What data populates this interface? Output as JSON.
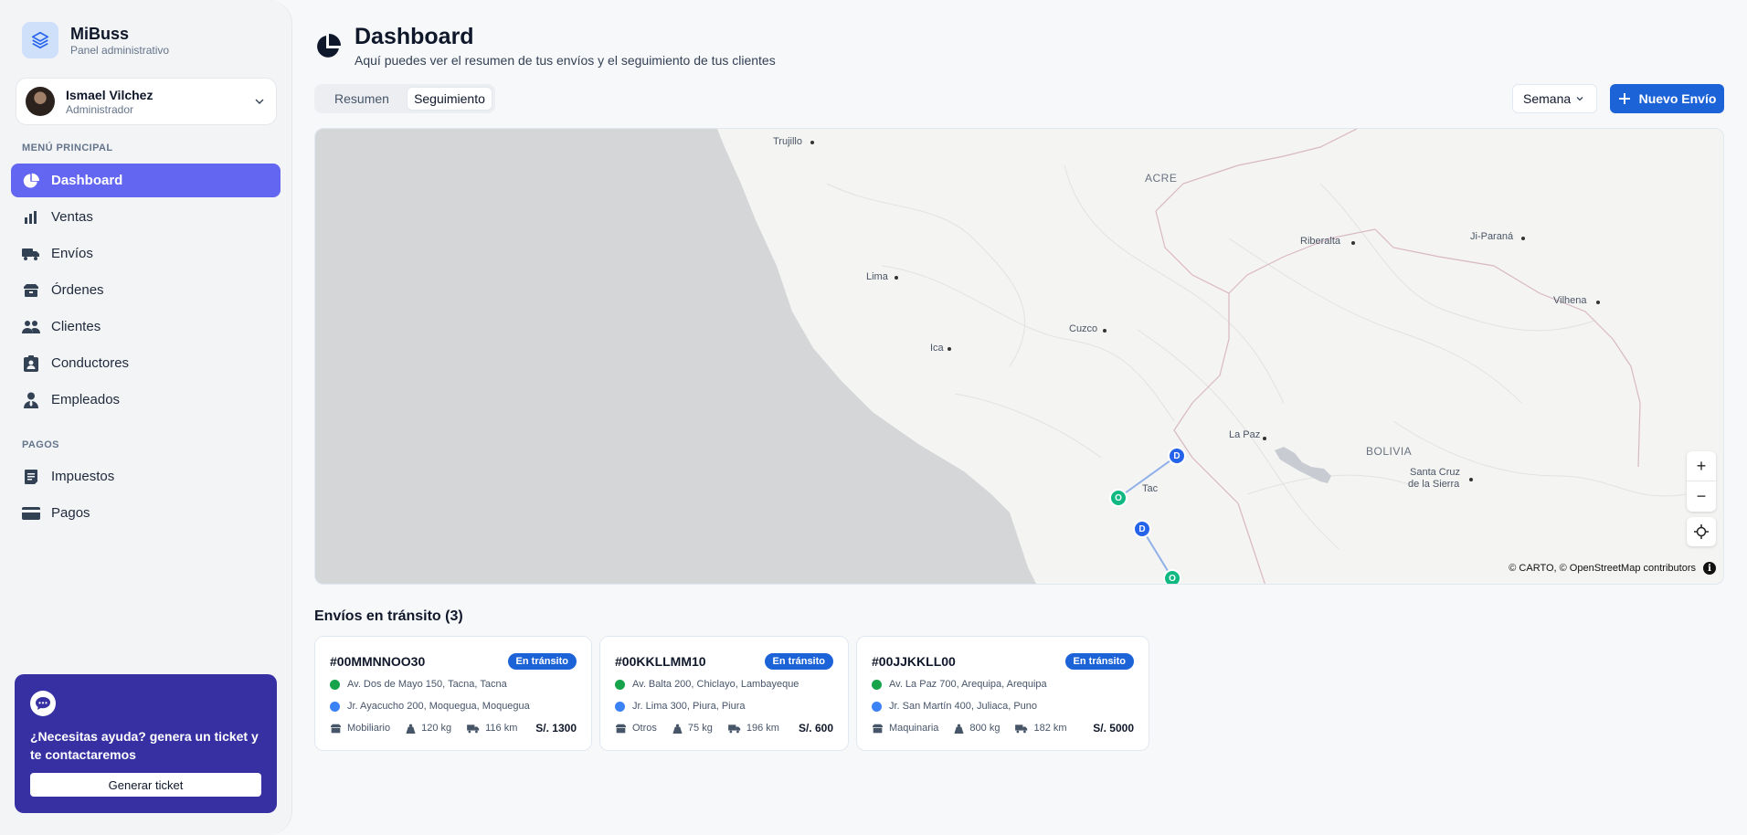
{
  "brand": {
    "name": "MiBuss",
    "subtitle": "Panel administrativo"
  },
  "user": {
    "name": "Ismael Vilchez",
    "role": "Administrador"
  },
  "sidebar": {
    "main_title": "MENÚ PRINCIPAL",
    "main_items": [
      {
        "label": "Dashboard",
        "icon": "pie-chart-icon",
        "active": true
      },
      {
        "label": "Ventas",
        "icon": "bar-chart-icon"
      },
      {
        "label": "Envíos",
        "icon": "truck-icon"
      },
      {
        "label": "Órdenes",
        "icon": "box-icon"
      },
      {
        "label": "Clientes",
        "icon": "users-icon"
      },
      {
        "label": "Conductores",
        "icon": "clipboard-user-icon"
      },
      {
        "label": "Empleados",
        "icon": "user-tie-icon"
      }
    ],
    "payments_title": "PAGOS",
    "payment_items": [
      {
        "label": "Impuestos",
        "icon": "receipt-icon"
      },
      {
        "label": "Pagos",
        "icon": "credit-card-icon"
      }
    ]
  },
  "help": {
    "text": "¿Necesitas ayuda? genera un ticket y te contactaremos",
    "button": "Generar ticket"
  },
  "header": {
    "title": "Dashboard",
    "subtitle": "Aquí puedes ver el resumen de tus envíos y el seguimiento de tus clientes"
  },
  "tabs": [
    {
      "label": "Resumen"
    },
    {
      "label": "Seguimiento",
      "active": true
    }
  ],
  "period": {
    "selected": "Semana"
  },
  "new_button": "Nuevo Envío",
  "map": {
    "labels": {
      "trujillo": "Trujillo",
      "acre": "ACRE",
      "riberalta": "Riberalta",
      "jiparana": "Ji-Paraná",
      "lima": "Lima",
      "vilhena": "Vilhena",
      "cuzco": "Cuzco",
      "ica": "Ica",
      "lapaz": "La Paz",
      "bolivia": "BOLIVIA",
      "santacruz1": "Santa Cruz",
      "santacruz2": "de la Sierra",
      "tacna": "Tac"
    },
    "marker_origin": "O",
    "marker_destination": "D",
    "zoom_in": "+",
    "zoom_out": "−",
    "attribution": "© CARTO, © OpenStreetMap contributors",
    "info": "i"
  },
  "shipments": {
    "title": "Envíos en tránsito (3)",
    "items": [
      {
        "id": "#00MMNNOO30",
        "status": "En tránsito",
        "origin": "Av. Dos de Mayo 150, Tacna, Tacna",
        "destination": "Jr. Ayacucho 200, Moquegua, Moquegua",
        "category": "Mobiliario",
        "weight": "120 kg",
        "distance": "116 km",
        "price": "S/. 1300"
      },
      {
        "id": "#00KKLLMM10",
        "status": "En tránsito",
        "origin": "Av. Balta 200, Chiclayo, Lambayeque",
        "destination": "Jr. Lima 300, Piura, Piura",
        "category": "Otros",
        "weight": "75 kg",
        "distance": "196 km",
        "price": "S/. 600"
      },
      {
        "id": "#00JJKKLL00",
        "status": "En tránsito",
        "origin": "Av. La Paz 700, Arequipa, Arequipa",
        "destination": "Jr. San Martín 400, Juliaca, Puno",
        "category": "Maquinaria",
        "weight": "800 kg",
        "distance": "182 km",
        "price": "S/. 5000"
      }
    ]
  },
  "colors": {
    "accent": "#6366f1",
    "primary_button": "#1d63d8",
    "help_card": "#3730a3",
    "origin_marker": "#10b981",
    "destination_marker": "#2563eb"
  }
}
